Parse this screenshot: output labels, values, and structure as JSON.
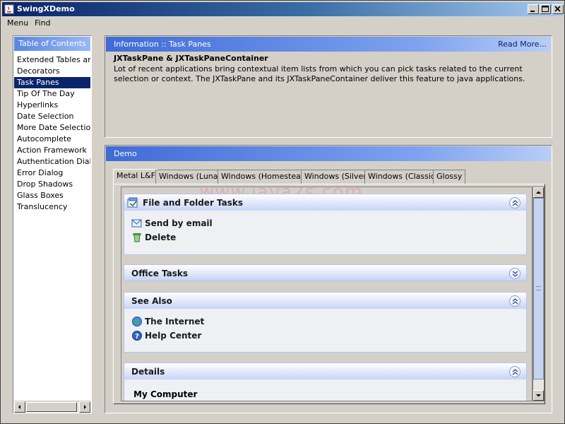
{
  "window": {
    "title": "SwingXDemo"
  },
  "menubar": {
    "items": [
      "Menu",
      "Find"
    ]
  },
  "toc": {
    "header": "Table of Contents",
    "items": [
      "Extended Tables and",
      "Decorators",
      "Task Panes",
      "Tip Of The Day",
      "Hyperlinks",
      "Date Selection",
      "More Date Selection",
      "Autocomplete",
      "Action Framework",
      "Authentication Dialogs",
      "Error Dialog",
      "Drop Shadows",
      "Glass Boxes",
      "Translucency"
    ],
    "selected_index": 2
  },
  "info": {
    "header": "Information :: Task Panes",
    "read_more": "Read More...",
    "title": "JXTaskPane & JXTaskPaneContainer",
    "text": "Lot of recent applications bring contextual item lists from which you can pick tasks related to the current selection or context. The JXTaskPane and its JXTaskPaneContainer deliver this feature to java applications."
  },
  "demo": {
    "header": "Demo",
    "tabs": [
      "Metal L&F",
      "Windows (Luna)",
      "Windows (Homestead)",
      "Windows (Silver)",
      "Windows (Classic)",
      "Glossy"
    ],
    "active_tab": 0,
    "watermark": "www.java2s.com",
    "panes": [
      {
        "title": "File and Folder Tasks",
        "icon": "folder-tasks-icon",
        "expanded": true,
        "links": [
          {
            "label": "Send by email",
            "icon": "email-icon"
          },
          {
            "label": "Delete",
            "icon": "delete-icon"
          }
        ]
      },
      {
        "title": "Office Tasks",
        "expanded": false,
        "links": []
      },
      {
        "title": "See Also",
        "expanded": true,
        "links": [
          {
            "label": "The Internet",
            "icon": "internet-icon"
          },
          {
            "label": "Help Center",
            "icon": "help-icon"
          }
        ]
      },
      {
        "title": "Details",
        "expanded": true,
        "body_text": "My Computer"
      }
    ]
  },
  "colors": {
    "title_bar": "#0a246a",
    "selection": "#0a246a",
    "panel_header": "#3f6bd6",
    "pane_header": "#c6d3f7"
  }
}
